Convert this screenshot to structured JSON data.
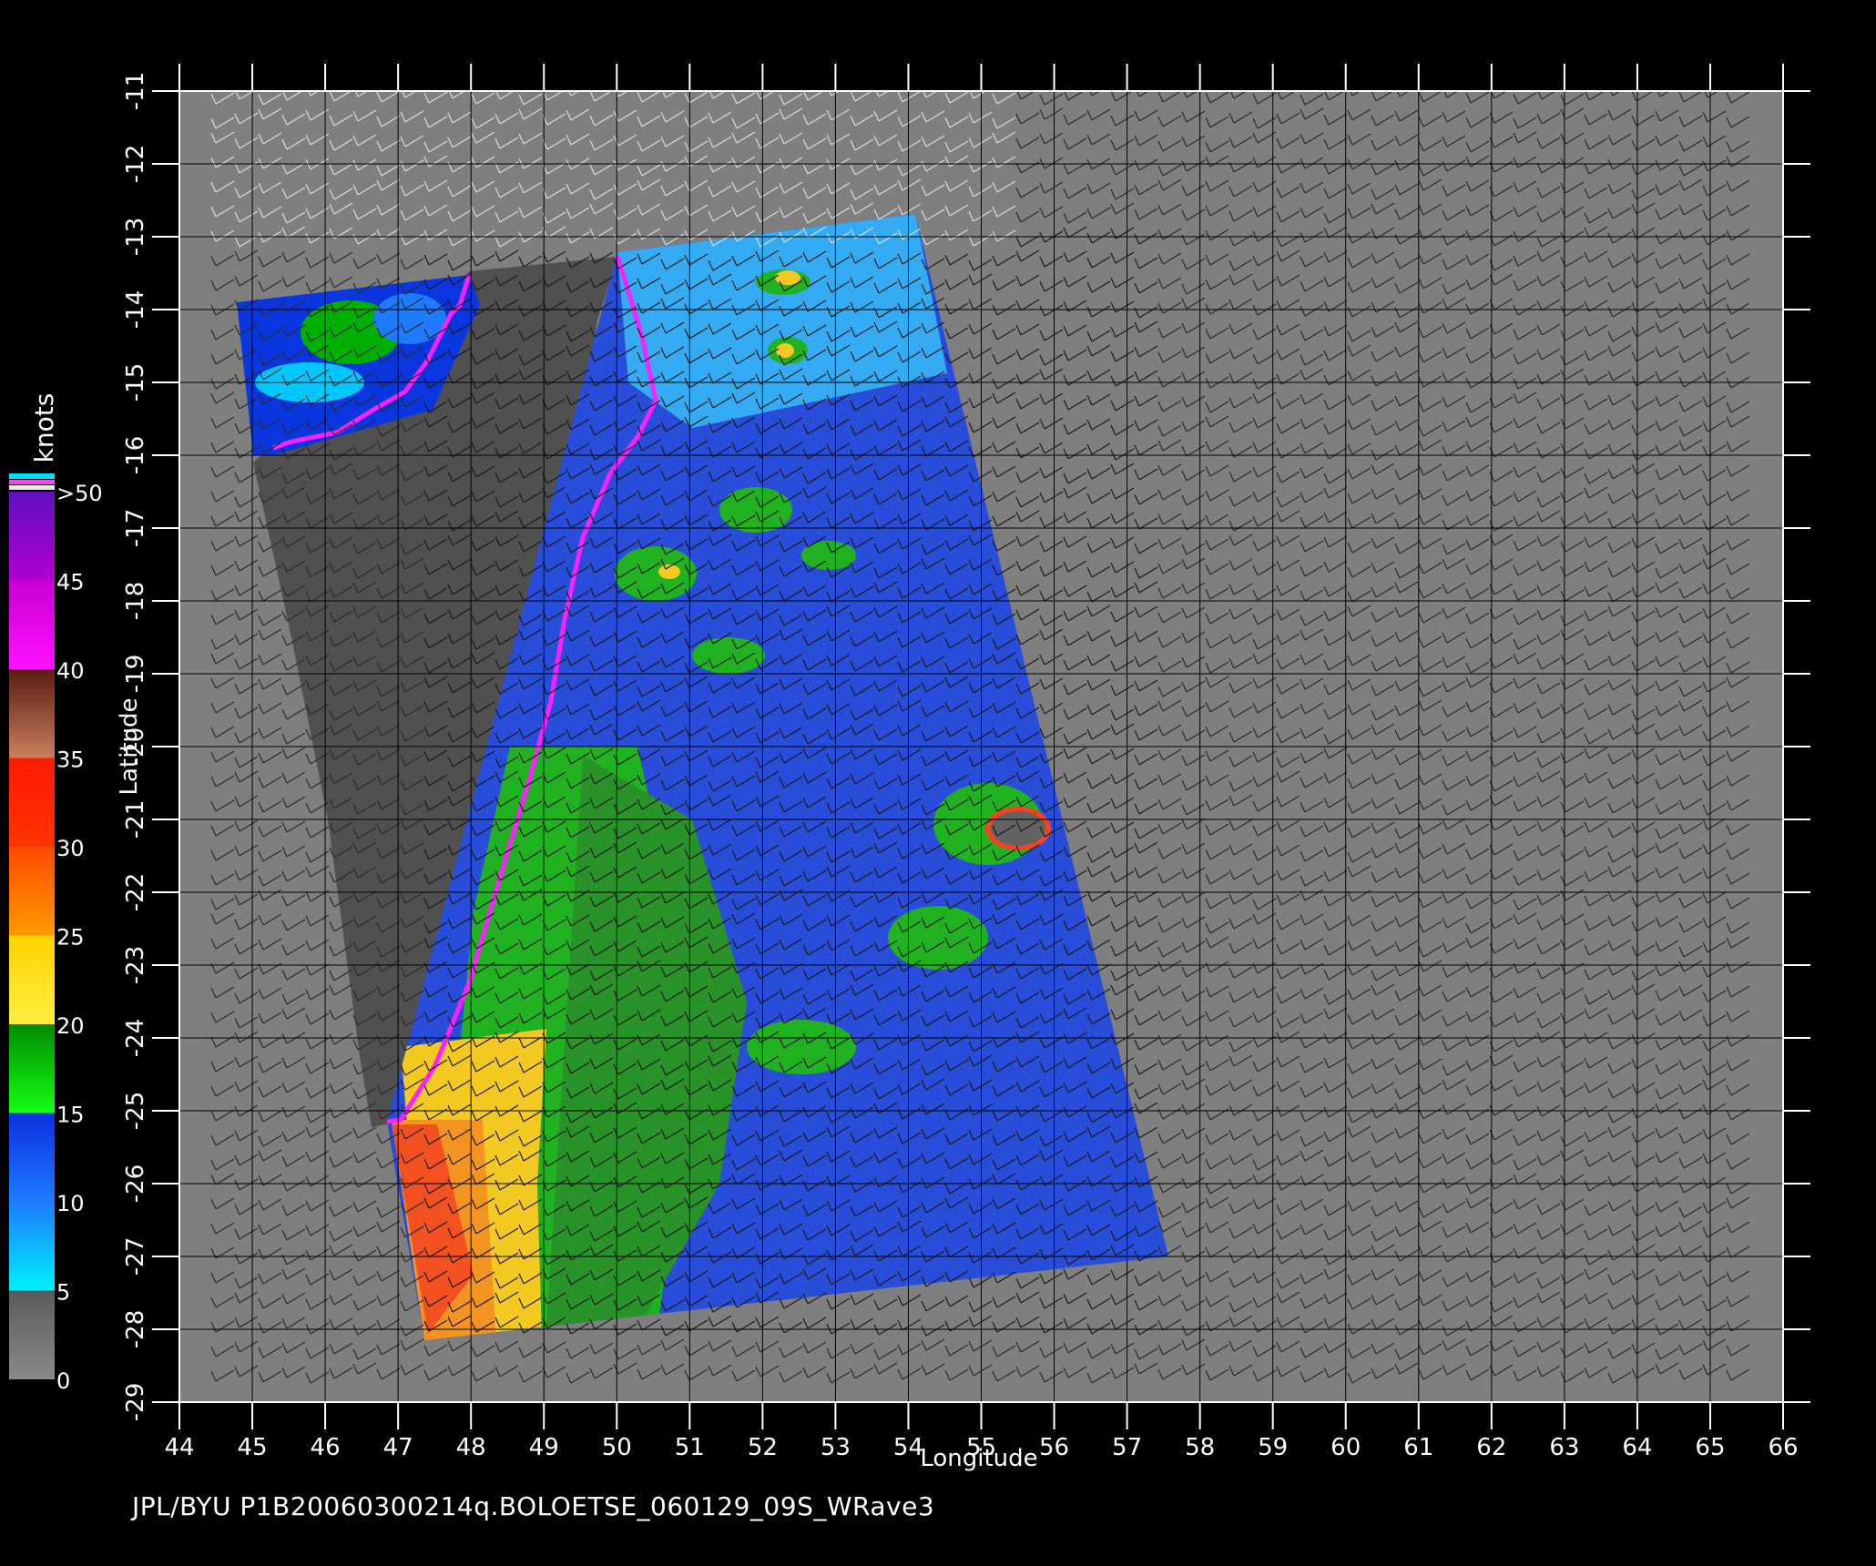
{
  "footer_text": "JPL/BYU  P1B20060300214q.BOLOETSE_060129_09S_WRave3",
  "axes": {
    "xlabel": "Longitude",
    "ylabel": "Latitude",
    "x_ticks": [
      44,
      45,
      46,
      47,
      48,
      49,
      50,
      51,
      52,
      53,
      54,
      55,
      56,
      57,
      58,
      59,
      60,
      61,
      62,
      63,
      64,
      65,
      66
    ],
    "y_ticks": [
      -11,
      -12,
      -13,
      -14,
      -15,
      -16,
      -17,
      -18,
      -19,
      -20,
      -21,
      -22,
      -23,
      -24,
      -25,
      -26,
      -27,
      -28,
      -29
    ],
    "xlim": [
      44,
      66
    ],
    "ylim": [
      -29,
      -11
    ]
  },
  "colorbar": {
    "unit": "knots",
    "tick_labels": [
      "0",
      "5",
      "10",
      "15",
      "20",
      "25",
      "30",
      "35",
      "40",
      "45",
      ">50"
    ],
    "tick_values": [
      0,
      5,
      10,
      15,
      20,
      25,
      30,
      35,
      40,
      45,
      50
    ],
    "stops": [
      {
        "from": 0,
        "to": 5,
        "top": "#5a5a5a",
        "bottom": "#8a8a8a"
      },
      {
        "from": 5,
        "to": 10,
        "top": "#1e7bff",
        "bottom": "#00f0ff"
      },
      {
        "from": 10,
        "to": 15,
        "top": "#0a2fe0",
        "bottom": "#1e7bff"
      },
      {
        "from": 15,
        "to": 20,
        "top": "#008a00",
        "bottom": "#16ff16"
      },
      {
        "from": 20,
        "to": 25,
        "top": "#ffd200",
        "bottom": "#ffee40"
      },
      {
        "from": 25,
        "to": 30,
        "top": "#ff4a00",
        "bottom": "#ff9a00"
      },
      {
        "from": 30,
        "to": 35,
        "top": "#ff1a00",
        "bottom": "#ff3300"
      },
      {
        "from": 35,
        "to": 40,
        "top": "#5a1b10",
        "bottom": "#c8805c"
      },
      {
        "from": 40,
        "to": 45,
        "top": "#c800d0",
        "bottom": "#ff10ff"
      },
      {
        "from": 45,
        "to": 50,
        "top": "#6010c0",
        "bottom": "#b000d0"
      }
    ]
  },
  "colors": {
    "background": "#000000",
    "map_fill": "#7f7f7f",
    "land": "#505050",
    "grid": "#000000",
    "calm": "#0a36e0",
    "moderate": "#00b000",
    "strong": "#ffcc00",
    "gale": "#ff3a00"
  }
}
